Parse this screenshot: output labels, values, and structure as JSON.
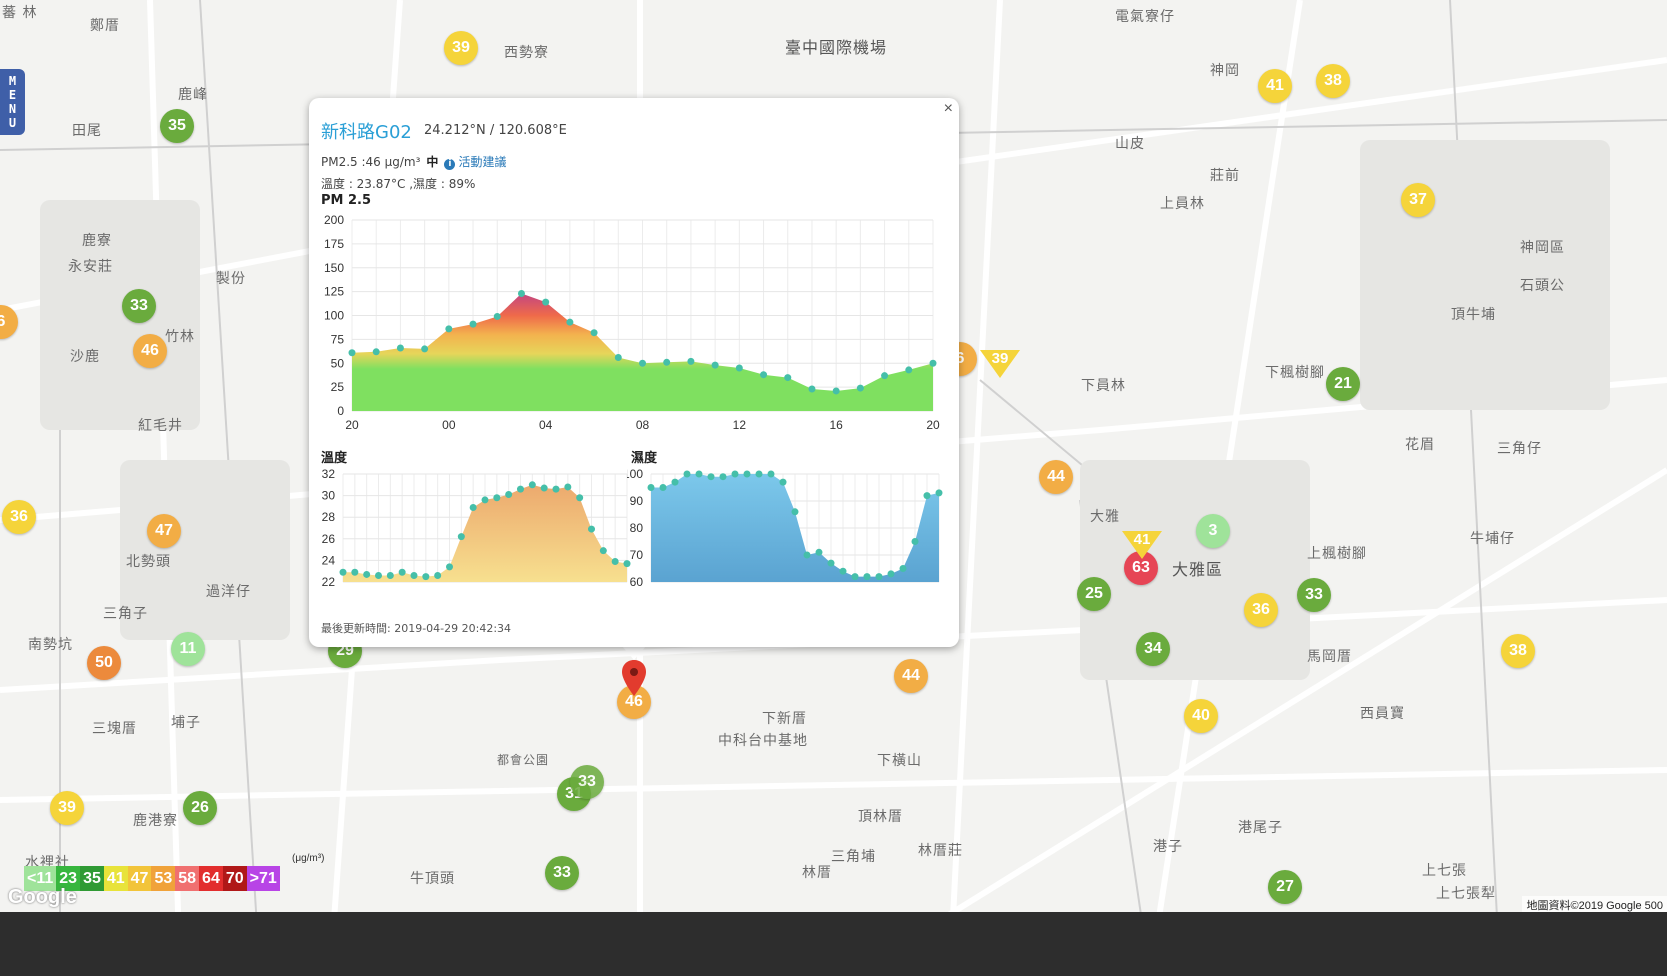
{
  "menu": {
    "label": "MENU"
  },
  "places": [
    {
      "name": "鄭厝"
    },
    {
      "name": "田尾"
    },
    {
      "name": "鹿峰"
    },
    {
      "name": "西勢寮"
    },
    {
      "name": "臺中國際機場"
    },
    {
      "name": "電氣寮仔"
    },
    {
      "name": "神岡"
    },
    {
      "name": "山皮"
    },
    {
      "name": "莊前"
    },
    {
      "name": "上員林"
    },
    {
      "name": "鹿寮"
    },
    {
      "name": "永安莊"
    },
    {
      "name": "竹林"
    },
    {
      "name": "沙鹿"
    },
    {
      "name": "紅毛井"
    },
    {
      "name": "神岡區"
    },
    {
      "name": "石頭公"
    },
    {
      "name": "頂牛埔"
    },
    {
      "name": "下員林"
    },
    {
      "name": "下楓樹腳"
    },
    {
      "name": "花眉"
    },
    {
      "name": "三角仔"
    },
    {
      "name": "大雅"
    },
    {
      "name": "大雅區"
    },
    {
      "name": "牛埔仔"
    },
    {
      "name": "上楓樹腳"
    },
    {
      "name": "北勢頭"
    },
    {
      "name": "過洋仔"
    },
    {
      "name": "三角子"
    },
    {
      "name": "南勢坑"
    },
    {
      "name": "三塊厝"
    },
    {
      "name": "埔子"
    },
    {
      "name": "鹿港寮"
    },
    {
      "name": "水裡社"
    },
    {
      "name": "牛頂頭"
    },
    {
      "name": "下新厝"
    },
    {
      "name": "中科台中基地"
    },
    {
      "name": "下橫山"
    },
    {
      "name": "頂林厝"
    },
    {
      "name": "三角埔"
    },
    {
      "name": "林厝莊"
    },
    {
      "name": "林厝"
    },
    {
      "name": "港子"
    },
    {
      "name": "港尾子"
    },
    {
      "name": "上七張"
    },
    {
      "name": "上七張犁"
    },
    {
      "name": "馬岡厝"
    },
    {
      "name": "西員寶"
    },
    {
      "name": "都會公園"
    },
    {
      "name": "製份"
    }
  ],
  "markers": [
    {
      "v": "39",
      "c": "#f5d43a"
    },
    {
      "v": "35",
      "c": "#6aab3d"
    },
    {
      "v": "33",
      "c": "#6aab3d"
    },
    {
      "v": "46",
      "c": "#f2ad45"
    },
    {
      "v": "36",
      "c": "#f5d43a"
    },
    {
      "v": "47",
      "c": "#f2ad45"
    },
    {
      "v": "11",
      "c": "#9fe39a"
    },
    {
      "v": "50",
      "c": "#ec8a3c"
    },
    {
      "v": "39",
      "c": "#f5d43a"
    },
    {
      "v": "26",
      "c": "#6aab3d"
    },
    {
      "v": "29",
      "c": "#6aab3d"
    },
    {
      "v": "31",
      "c": "#6aab3d"
    },
    {
      "v": "33",
      "c": "#6aab3d"
    },
    {
      "v": "33",
      "c": "#6aab3d"
    },
    {
      "v": "46",
      "c": "#f2ad45"
    },
    {
      "v": "44",
      "c": "#f2ad45"
    },
    {
      "v": "44",
      "c": "#f2ad45"
    },
    {
      "v": "25",
      "c": "#6aab3d"
    },
    {
      "v": "63",
      "c": "#e64555"
    },
    {
      "v": "3",
      "c": "#9fe39a"
    },
    {
      "v": "36",
      "c": "#f5d43a"
    },
    {
      "v": "33",
      "c": "#6aab3d"
    },
    {
      "v": "34",
      "c": "#6aab3d"
    },
    {
      "v": "40",
      "c": "#f5d43a"
    },
    {
      "v": "38",
      "c": "#f5d43a"
    },
    {
      "v": "27",
      "c": "#6aab3d"
    },
    {
      "v": "21",
      "c": "#6aab3d"
    },
    {
      "v": "37",
      "c": "#f5d43a"
    },
    {
      "v": "41",
      "c": "#f5d43a"
    },
    {
      "v": "38",
      "c": "#f5d43a"
    },
    {
      "v": "6",
      "c": "#f2ad45"
    },
    {
      "v": "6",
      "c": "#f2ad45"
    }
  ],
  "triangles": [
    {
      "v": "39",
      "c": "#f5d43a"
    },
    {
      "v": "41",
      "c": "#f5d43a"
    }
  ],
  "popup": {
    "close": "×",
    "station": "新科路G02",
    "coords": "24.212°N / 120.608°E",
    "pm_text": "PM2.5 :46 μg/m³",
    "level": "中",
    "advice": "活動建議",
    "temp_humid": "溫度 : 23.87°C ,濕度 : 89%",
    "updated": "最後更新時間: 2019-04-29 20:42:34"
  },
  "chart_data": [
    {
      "type": "area",
      "title": "PM 2.5",
      "x": [
        "20",
        "21",
        "22",
        "23",
        "00",
        "01",
        "02",
        "03",
        "04",
        "05",
        "06",
        "07",
        "08",
        "09",
        "10",
        "11",
        "12",
        "13",
        "14",
        "15",
        "16",
        "17",
        "18",
        "19",
        "20"
      ],
      "x_ticks": [
        "20",
        "00",
        "04",
        "08",
        "12",
        "16",
        "20"
      ],
      "values": [
        61,
        62,
        66,
        65,
        86,
        91,
        99,
        123,
        114,
        93,
        82,
        56,
        50,
        51,
        52,
        48,
        45,
        38,
        35,
        23,
        21,
        24,
        37,
        43,
        50
      ],
      "ylim": [
        0,
        200
      ],
      "y_ticks": [
        0,
        25,
        50,
        75,
        100,
        125,
        150,
        175,
        200
      ]
    },
    {
      "type": "area",
      "title": "溫度",
      "values": [
        22.9,
        22.9,
        22.7,
        22.6,
        22.6,
        22.9,
        22.6,
        22.5,
        22.6,
        23.4,
        26.2,
        28.9,
        29.6,
        29.8,
        30.1,
        30.6,
        31.0,
        30.7,
        30.6,
        30.8,
        29.8,
        26.9,
        24.9,
        23.9,
        23.7
      ],
      "ylim": [
        22,
        32
      ],
      "y_ticks": [
        22,
        24,
        26,
        28,
        30,
        32
      ]
    },
    {
      "type": "area",
      "title": "濕度",
      "values": [
        95,
        95,
        97,
        100,
        100,
        99,
        99,
        100,
        100,
        100,
        100,
        97,
        86,
        70,
        71,
        67,
        64,
        62,
        62,
        62,
        63,
        65,
        75,
        92,
        93
      ],
      "ylim": [
        60,
        100
      ],
      "y_ticks": [
        60,
        70,
        80,
        90,
        100
      ]
    }
  ],
  "legend": {
    "unit": "(μg/m³)",
    "items": [
      {
        "label": "<11",
        "c": "#9fe39a"
      },
      {
        "label": "23",
        "c": "#37b63e"
      },
      {
        "label": "35",
        "c": "#2f9a34"
      },
      {
        "label": "41",
        "c": "#e8e33a"
      },
      {
        "label": "47",
        "c": "#f2c43a"
      },
      {
        "label": "53",
        "c": "#f0a23a"
      },
      {
        "label": "58",
        "c": "#f07070"
      },
      {
        "label": "64",
        "c": "#e22d2d"
      },
      {
        "label": "70",
        "c": "#b01818"
      },
      {
        "label": ">71",
        "c": "#b844e6"
      }
    ]
  },
  "attribution": {
    "google": "Google",
    "copyright": "地圖資料©2019 Google  500"
  },
  "colors": {
    "accent": "#2a9fd6",
    "menu": "#3f5fa8"
  }
}
